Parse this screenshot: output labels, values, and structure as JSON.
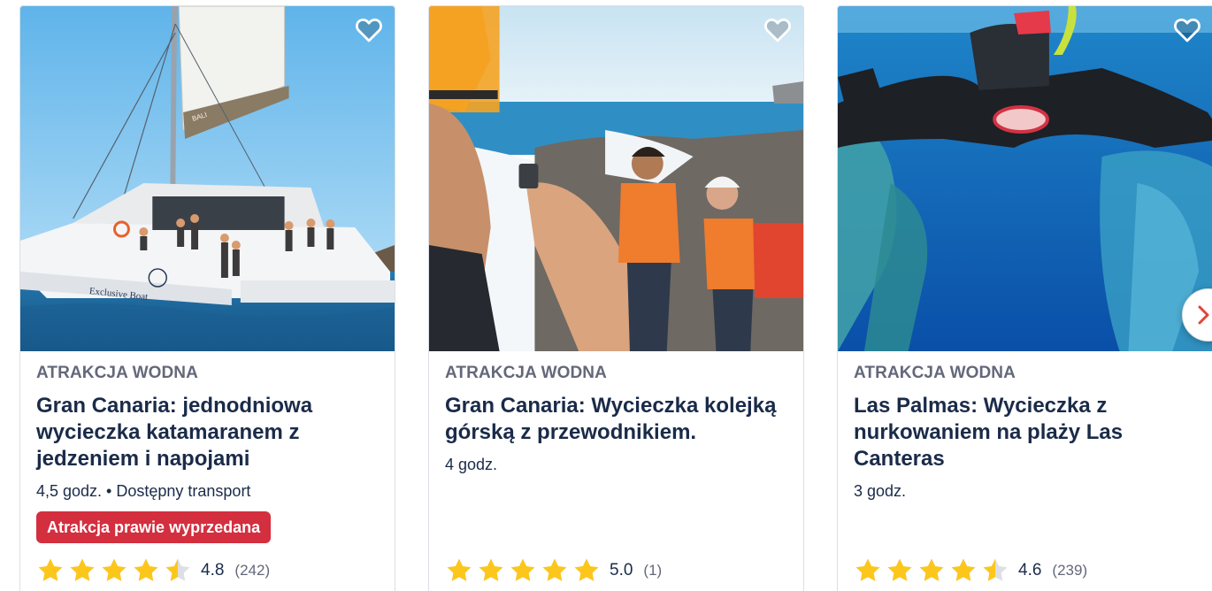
{
  "cards": [
    {
      "category": "ATRAKCJA WODNA",
      "title": "Gran Canaria: jednodniowa wycieczka katamaranem z jedzeniem i napojami",
      "meta": "4,5 godz. • Dostępny transport",
      "badge": "Atrakcja prawie wyprzedana",
      "rating": "4.8",
      "rating_stars": 4.8,
      "reviews": "(242)",
      "image": "catamaran-photo",
      "boat_label": "Exclusive Boat",
      "boat_logo": "BALI"
    },
    {
      "category": "ATRAKCJA WODNA",
      "title": "Gran Canaria: Wycieczka kolejką górską z przewodnikiem.",
      "meta": "4 godz.",
      "rating": "5.0",
      "rating_stars": 5.0,
      "reviews": "(1)",
      "image": "coasteering-photo"
    },
    {
      "category": "ATRAKCJA WODNA",
      "title": "Las Palmas: Wycieczka z nurkowaniem na plaży Las Canteras",
      "meta": "3 godz.",
      "rating": "4.6",
      "rating_stars": 4.6,
      "reviews": "(239)",
      "image": "snorkeling-photo"
    }
  ],
  "icons": {
    "wishlist": "heart-outline-icon",
    "star": "star-icon",
    "next": "chevron-right-icon"
  },
  "colors": {
    "star": "#fdc61b",
    "star_empty": "#dcdfe4",
    "badge": "#d32f3f",
    "next_chevron": "#e0453a",
    "title": "#1a2b49",
    "category": "#63687a"
  }
}
